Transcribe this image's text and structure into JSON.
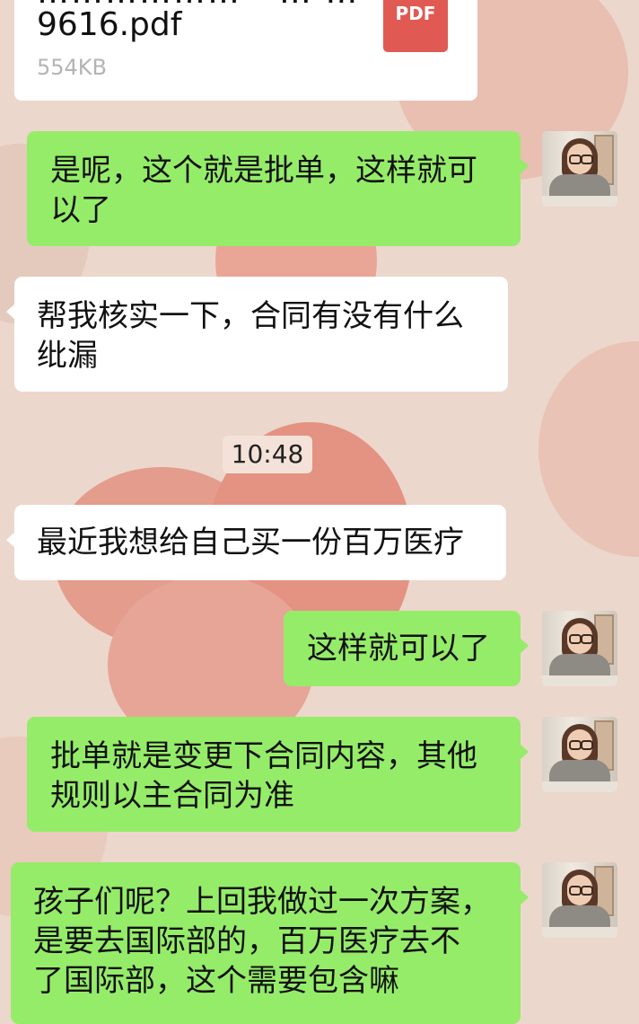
{
  "file": {
    "name_partial": "……………… - … …",
    "name": "9616.pdf",
    "size": "554KB",
    "icon_label": "PDF"
  },
  "time": "10:48",
  "messages": [
    {
      "dir": "out",
      "lines": [
        "是呢，这个就是批单，这样就可",
        "以了"
      ]
    },
    {
      "dir": "in",
      "lines": [
        "帮我核实一下，合同有没有什么",
        "纰漏"
      ]
    },
    {
      "dir": "in",
      "lines": [
        "最近我想给自己买一份百万医疗"
      ]
    },
    {
      "dir": "out",
      "lines": [
        "这样就可以了"
      ]
    },
    {
      "dir": "out",
      "lines": [
        "批单就是变更下合同内容，其他",
        "规则以主合同为准"
      ]
    },
    {
      "dir": "out",
      "lines": [
        "孩子们呢？上回我做过一次方案，",
        "是要去国际部的，百万医疗去不",
        "了国际部，这个需要包含嘛"
      ]
    }
  ]
}
